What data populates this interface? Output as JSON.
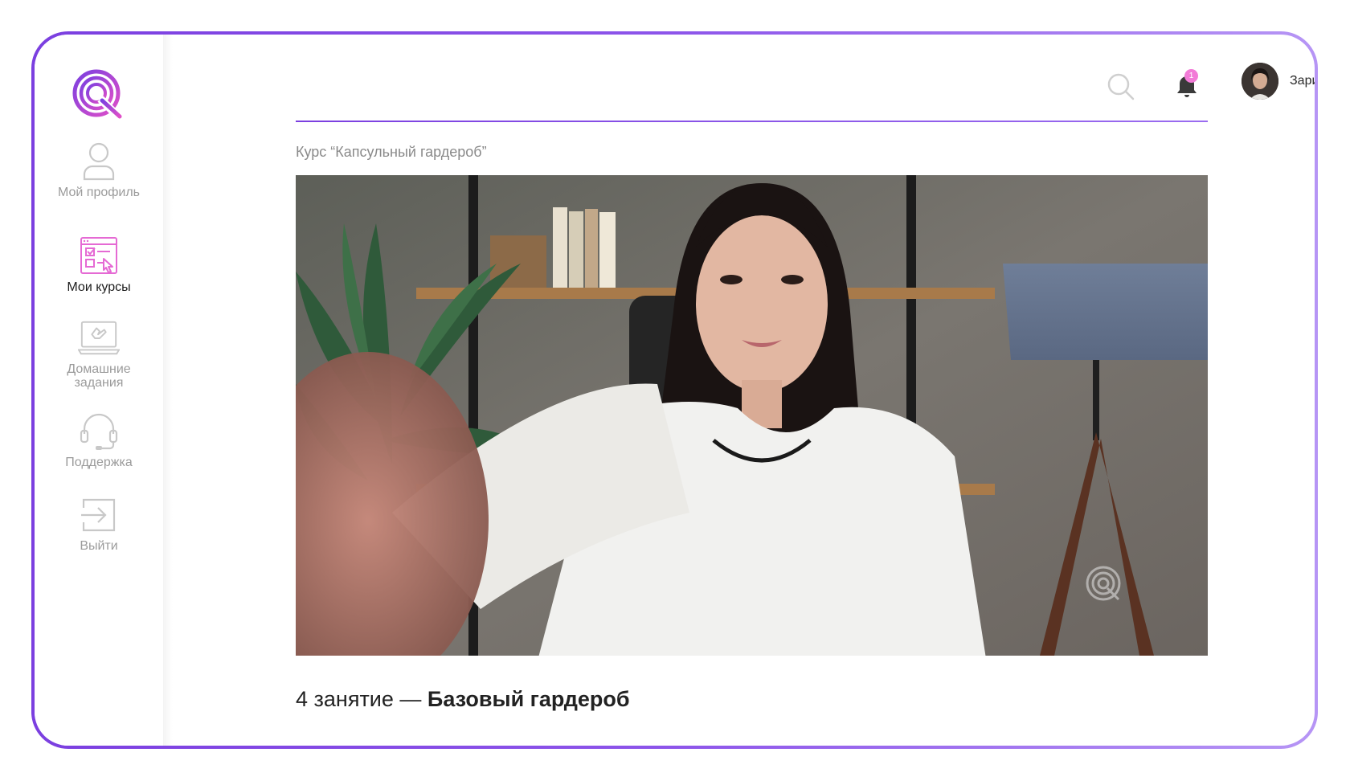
{
  "sidebar": {
    "items": [
      {
        "label": "Мой профиль",
        "icon": "user-icon"
      },
      {
        "label": "Мои курсы",
        "icon": "courses-icon",
        "active": true
      },
      {
        "label": "Домашние задания",
        "icon": "homework-icon"
      },
      {
        "label": "Поддержка",
        "icon": "headset-icon"
      },
      {
        "label": "Выйти",
        "icon": "logout-icon"
      }
    ]
  },
  "header": {
    "notifications_count": "1",
    "user_name": "Зарина"
  },
  "main": {
    "breadcrumb": "Курс “Капсульный гардероб”",
    "lesson_prefix": "4 занятие — ",
    "lesson_title": "Базовый гардероб"
  },
  "colors": {
    "accent": "#7b3fe0",
    "pink": "#f27bd7",
    "text_muted": "#9b9b9b"
  }
}
